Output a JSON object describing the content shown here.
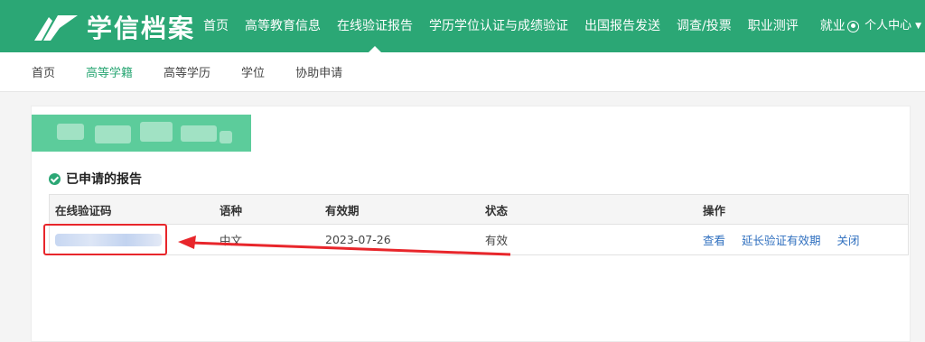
{
  "header": {
    "brand": "学信档案",
    "nav": [
      {
        "label": "首页",
        "active": false
      },
      {
        "label": "高等教育信息",
        "active": false
      },
      {
        "label": "在线验证报告",
        "active": true
      },
      {
        "label": "学历学位认证与成绩验证",
        "active": false
      },
      {
        "label": "出国报告发送",
        "active": false
      },
      {
        "label": "调查/投票",
        "active": false
      },
      {
        "label": "职业测评",
        "active": false
      },
      {
        "label": "就业",
        "active": false
      }
    ],
    "user_label": "个人中心",
    "brand_color": "#2ba775"
  },
  "subnav": {
    "items": [
      {
        "label": "首页",
        "active": false
      },
      {
        "label": "高等学籍",
        "active": true
      },
      {
        "label": "高等学历",
        "active": false
      },
      {
        "label": "学位",
        "active": false
      },
      {
        "label": "协助申请",
        "active": false
      }
    ]
  },
  "section": {
    "title": "已申请的报告"
  },
  "table": {
    "columns": [
      "在线验证码",
      "语种",
      "有效期",
      "状态",
      "操作"
    ],
    "rows": [
      {
        "language": "中文",
        "expiry": "2023-07-26",
        "status": "有效",
        "actions": [
          "查看",
          "延长验证有效期",
          "关闭"
        ]
      }
    ]
  },
  "annotation": {
    "highlight_color": "#e8262b"
  }
}
